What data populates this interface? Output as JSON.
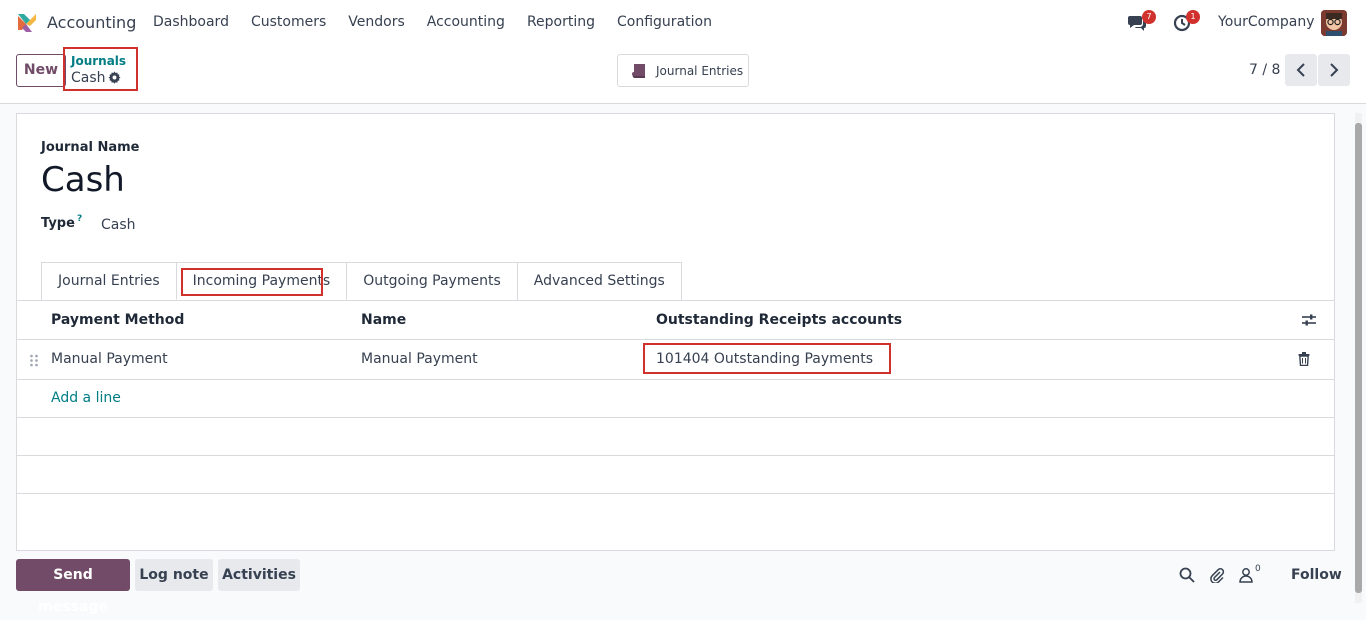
{
  "app": {
    "name": "Accounting"
  },
  "menu": [
    "Dashboard",
    "Customers",
    "Vendors",
    "Accounting",
    "Reporting",
    "Configuration"
  ],
  "systray": {
    "messages_count": "7",
    "activities_count": "1",
    "company": "YourCompany"
  },
  "control": {
    "new_label": "New",
    "breadcrumb_parent": "Journals",
    "breadcrumb_current": "Cash",
    "smart_button": "Journal Entries",
    "pager": "7 / 8"
  },
  "form": {
    "journal_name_label": "Journal Name",
    "journal_name": "Cash",
    "type_label": "Type",
    "type_help": "?",
    "type_value": "Cash"
  },
  "tabs": [
    "Journal Entries",
    "Incoming Payments",
    "Outgoing Payments",
    "Advanced Settings"
  ],
  "active_tab": "Incoming Payments",
  "table": {
    "headers": [
      "Payment Method",
      "Name",
      "Outstanding Receipts accounts"
    ],
    "rows": [
      {
        "payment_method": "Manual Payment",
        "name": "Manual Payment",
        "account": "101404 Outstanding Payments"
      }
    ],
    "add_line": "Add a line"
  },
  "chatter": {
    "send_message": "Send message",
    "log_note": "Log note",
    "activities": "Activities",
    "followers_count": "0",
    "follow": "Follow"
  },
  "colors": {
    "brand": "#714b67",
    "link": "#017e84",
    "highlight": "#d0312d"
  }
}
